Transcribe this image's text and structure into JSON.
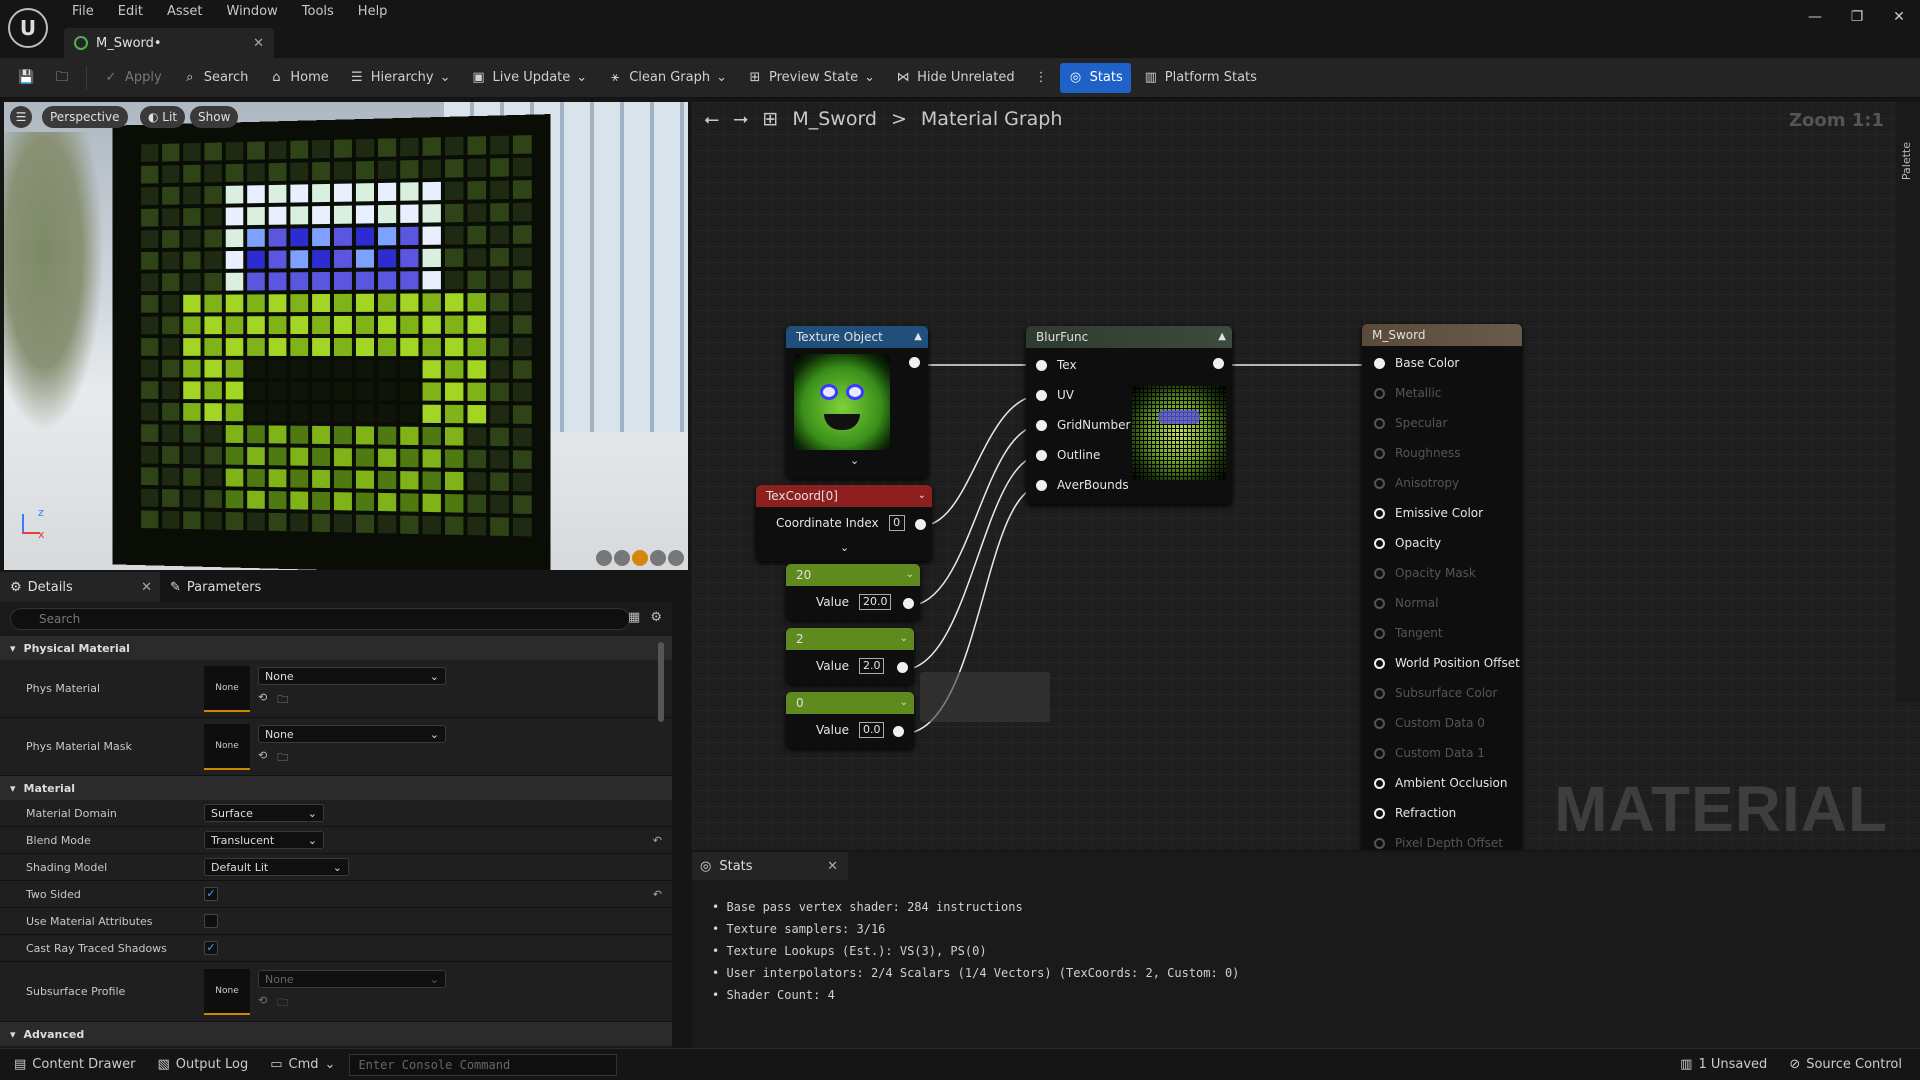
{
  "menu": [
    "File",
    "Edit",
    "Asset",
    "Window",
    "Tools",
    "Help"
  ],
  "doc_tab": "M_Sword•",
  "toolbar": {
    "apply": "Apply",
    "search": "Search",
    "home": "Home",
    "hierarchy": "Hierarchy",
    "live_update": "Live Update",
    "clean_graph": "Clean Graph",
    "preview_state": "Preview State",
    "hide_unrelated": "Hide Unrelated",
    "stats": "Stats",
    "platform_stats": "Platform Stats"
  },
  "viewport": {
    "perspective": "Perspective",
    "lit": "Lit",
    "show": "Show",
    "axis_z": "z",
    "axis_x": "x"
  },
  "details": {
    "tab_details": "Details",
    "tab_parameters": "Parameters",
    "search_placeholder": "Search",
    "cat_physical": "Physical Material",
    "phys_material": "Phys Material",
    "phys_material_val": "None",
    "thumb_none": "None",
    "phys_material_mask": "Phys Material Mask",
    "phys_material_mask_val": "None",
    "cat_material": "Material",
    "material_domain": "Material Domain",
    "material_domain_val": "Surface",
    "blend_mode": "Blend Mode",
    "blend_mode_val": "Translucent",
    "shading_model": "Shading Model",
    "shading_model_val": "Default Lit",
    "two_sided": "Two Sided",
    "use_material_attributes": "Use Material Attributes",
    "cast_ray_traced_shadows": "Cast Ray Traced Shadows",
    "subsurface_profile": "Subsurface Profile",
    "subsurface_profile_val": "None",
    "cat_advanced": "Advanced"
  },
  "graph": {
    "breadcrumb_asset": "M_Sword",
    "breadcrumb_sep": ">",
    "breadcrumb_page": "Material Graph",
    "zoom": "Zoom 1:1",
    "palette": "Palette",
    "watermark": "MATERIAL",
    "texture_object": "Texture Object",
    "texcoord": "TexCoord[0]",
    "coord_index_label": "Coordinate Index",
    "coord_index_val": "0",
    "const1_title": "20",
    "const1_label": "Value",
    "const1_val": "20.0",
    "const2_title": "2",
    "const2_label": "Value",
    "const2_val": "2.0",
    "const3_title": "0",
    "const3_label": "Value",
    "const3_val": "0.0",
    "blurfunc": "BlurFunc",
    "blur_pins": [
      "Tex",
      "UV",
      "GridNumber",
      "Outline",
      "AverBounds"
    ],
    "result": "M_Sword",
    "result_pins": [
      {
        "label": "Base Color",
        "active": true
      },
      {
        "label": "Metallic",
        "active": false
      },
      {
        "label": "Specular",
        "active": false
      },
      {
        "label": "Roughness",
        "active": false
      },
      {
        "label": "Anisotropy",
        "active": false
      },
      {
        "label": "Emissive Color",
        "active": true
      },
      {
        "label": "Opacity",
        "active": true
      },
      {
        "label": "Opacity Mask",
        "active": false
      },
      {
        "label": "Normal",
        "active": false
      },
      {
        "label": "Tangent",
        "active": false
      },
      {
        "label": "World Position Offset",
        "active": true
      },
      {
        "label": "Subsurface Color",
        "active": false
      },
      {
        "label": "Custom Data 0",
        "active": false
      },
      {
        "label": "Custom Data 1",
        "active": false
      },
      {
        "label": "Ambient Occlusion",
        "active": true
      },
      {
        "label": "Refraction",
        "active": true
      },
      {
        "label": "Pixel Depth Offset",
        "active": false
      }
    ]
  },
  "stats": {
    "tab": "Stats",
    "lines": [
      "Base pass vertex shader: 284 instructions",
      "Texture samplers: 3/16",
      "Texture Lookups (Est.): VS(3), PS(0)",
      "User interpolators: 2/4 Scalars (1/4 Vectors) (TexCoords: 2, Custom: 0)",
      "Shader Count: 4"
    ]
  },
  "status": {
    "content_drawer": "Content Drawer",
    "output_log": "Output Log",
    "cmd": "Cmd",
    "console_placeholder": "Enter Console Command",
    "unsaved": "1 Unsaved",
    "source_control": "Source Control"
  },
  "colors": {
    "accent": "#1e62c8",
    "texture_header": "#1f4f7a",
    "texcoord_header": "#8e1f1f",
    "const_header": "#5f8a1e",
    "function_header": "#2e3b2e",
    "result_header": "#5a4a3a"
  }
}
